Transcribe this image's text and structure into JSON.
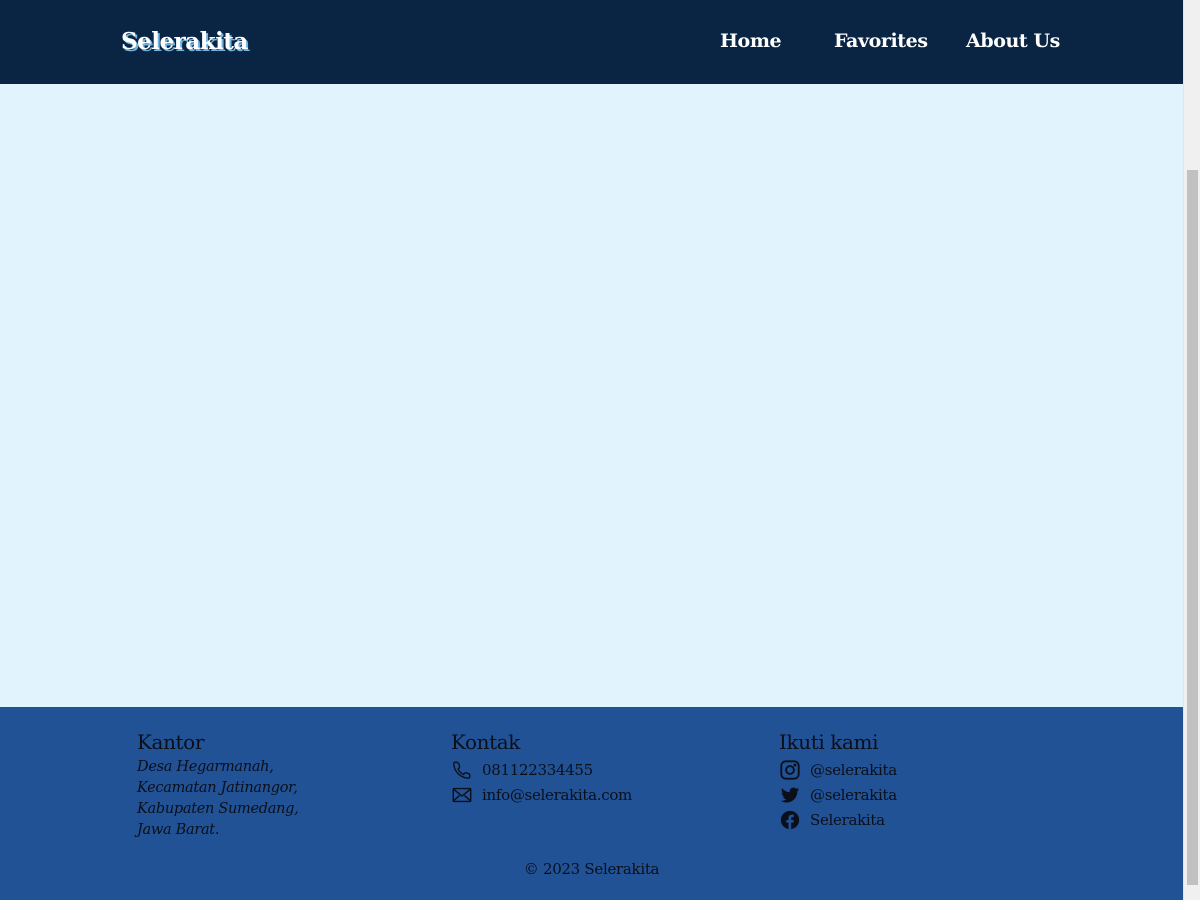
{
  "header": {
    "brand": "Selerakita",
    "nav": [
      {
        "label": "Home"
      },
      {
        "label": "Favorites"
      },
      {
        "label": "About Us"
      }
    ]
  },
  "footer": {
    "kantor": {
      "title": "Kantor",
      "address_lines": [
        "Desa Hegarmanah,",
        "Kecamatan Jatinangor,",
        "Kabupaten Sumedang,",
        "Jawa Barat."
      ]
    },
    "kontak": {
      "title": "Kontak",
      "phone": {
        "icon": "phone-icon",
        "text": "081122334455"
      },
      "email": {
        "icon": "mail-icon",
        "text": "info@selerakita.com"
      }
    },
    "ikuti": {
      "title": "Ikuti kami",
      "instagram": {
        "icon": "instagram-icon",
        "text": "@selerakita"
      },
      "twitter": {
        "icon": "twitter-icon",
        "text": "@selerakita"
      },
      "facebook": {
        "icon": "facebook-icon",
        "text": "Selerakita"
      }
    },
    "copyright": "© 2023 Selerakita"
  },
  "colors": {
    "header_bg": "#0a2444",
    "main_bg": "#e1f4fe",
    "footer_bg": "#215296",
    "brand_shadow": "#6fb3e0"
  }
}
